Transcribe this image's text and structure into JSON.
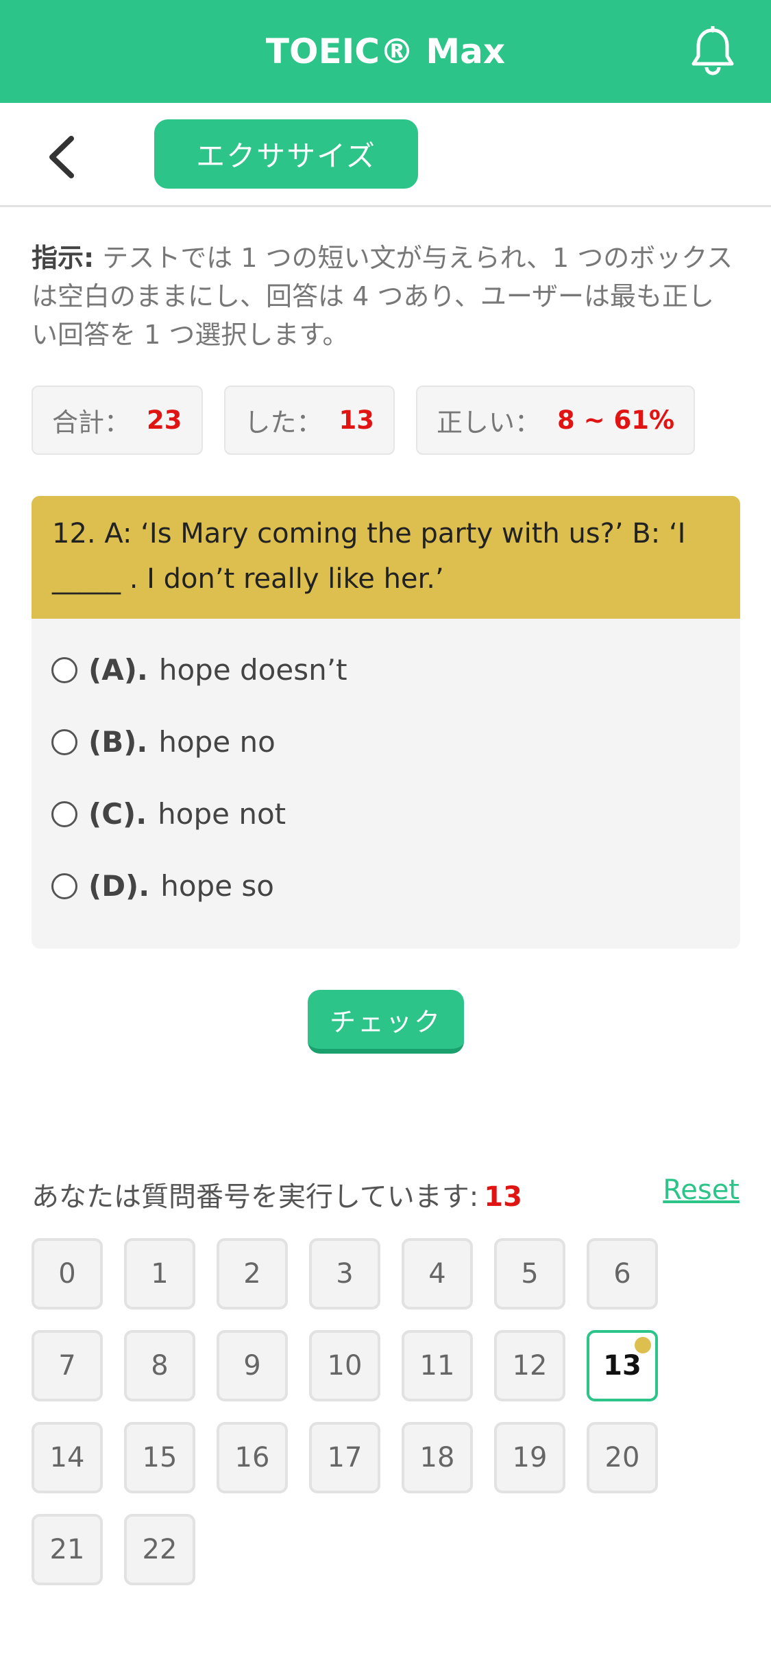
{
  "header": {
    "title": "TOEIC® Max",
    "bell_icon": "bell-icon"
  },
  "subheader": {
    "back_icon": "chevron-left-icon",
    "tab_label": "エクササイズ"
  },
  "instructions": {
    "prefix": "指示:",
    "text": " テストでは 1 つの短い文が与えられ、1 つのボックスは空白のままにし、回答は 4 つあり、ユーザーは最も正しい回答を 1 つ選択します。"
  },
  "stats": [
    {
      "label": "合計：",
      "value": "23"
    },
    {
      "label": "した：",
      "value": "13"
    },
    {
      "label": "正しい：",
      "value": "8 ~ 61%"
    }
  ],
  "question": {
    "text_line1": "12. A: ‘Is Mary coming the party with us?’ B: ‘I",
    "text_line2": "_____ . I don’t really like her.’",
    "options": [
      {
        "letter": "(A).",
        "text": "hope doesn’t"
      },
      {
        "letter": "(B).",
        "text": "hope no"
      },
      {
        "letter": "(C).",
        "text": "hope not"
      },
      {
        "letter": "(D).",
        "text": "hope so"
      }
    ]
  },
  "check_label": "チェック",
  "progress": {
    "label": "あなたは質問番号を実行しています:",
    "current": "13",
    "reset_label": "Reset",
    "numbers": [
      "0",
      "1",
      "2",
      "3",
      "4",
      "5",
      "6",
      "7",
      "8",
      "9",
      "10",
      "11",
      "12",
      "13",
      "14",
      "15",
      "16",
      "17",
      "18",
      "19",
      "20",
      "21",
      "22"
    ]
  },
  "colors": {
    "accent": "#2dc48a",
    "question_bg": "#dcbf4e",
    "highlight": "#e11414"
  }
}
